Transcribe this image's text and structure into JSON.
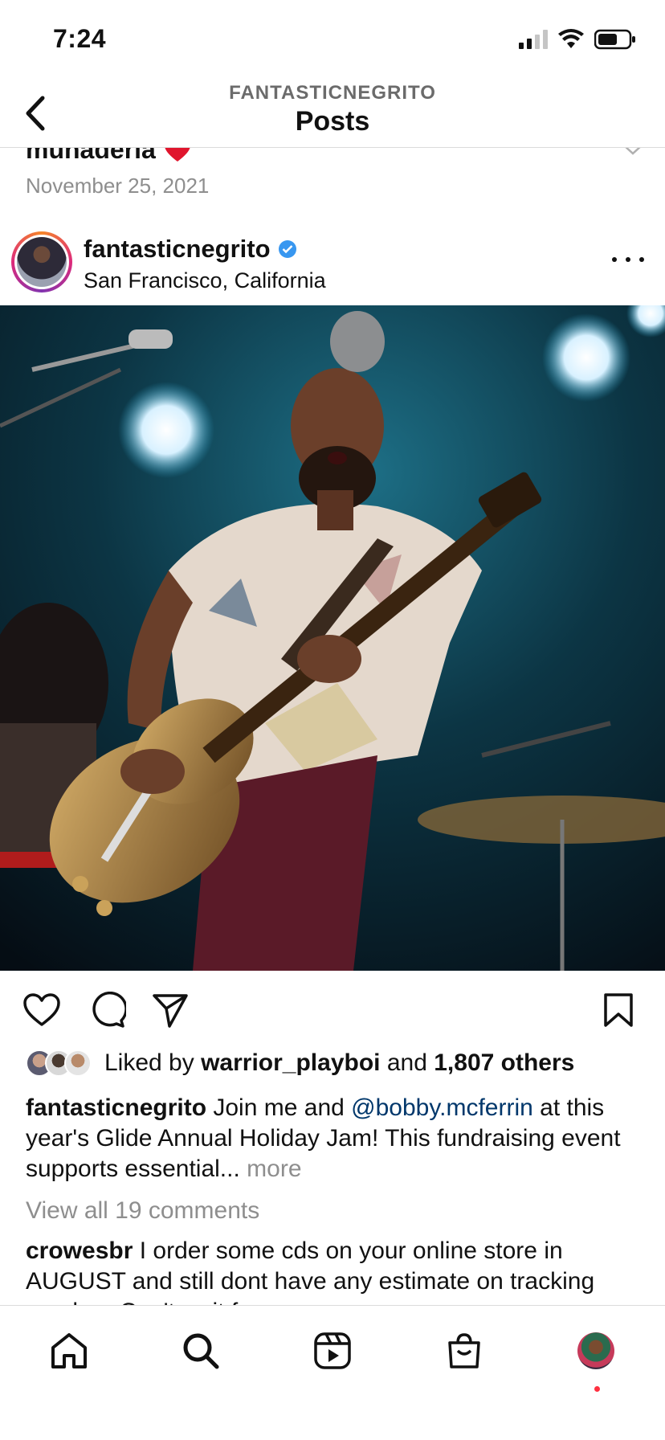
{
  "status_bar": {
    "time": "7:24",
    "signal_bars": 2,
    "battery_level": 0.55
  },
  "header": {
    "username": "FANTASTICNEGRITO",
    "title": "Posts"
  },
  "previous_post": {
    "caption_fragment": "muñadería",
    "date": "November 25, 2021"
  },
  "post": {
    "username": "fantasticnegrito",
    "location": "San Francisco, California",
    "verified": true,
    "likes": {
      "prefix": "Liked by",
      "liker": "warrior_playboi",
      "joiner": "and",
      "others": "1,807 others"
    },
    "caption": {
      "username": "fantasticnegrito",
      "text_before": "Join me and",
      "mention": "@bobby.mcferrin",
      "text_after": "at this year's Glide Annual Holiday Jam! This fundraising event supports essential...",
      "more_label": "more"
    },
    "view_comments": "View all 19 comments",
    "top_comment": {
      "username": "crowesbr",
      "text": "I order some cds on your online store in AUGUST and still dont have any estimate on tracking number. Can't wait for..."
    }
  },
  "icons": {
    "back": "chevron-left-icon",
    "like": "heart-icon",
    "comment": "comment-icon",
    "share": "send-icon",
    "save": "bookmark-icon"
  },
  "tab_bar": [
    "home",
    "search",
    "reels",
    "shop",
    "profile"
  ],
  "colors": {
    "accent_link": "#00376b",
    "verified": "#3897f0",
    "notification": "#ff3040",
    "muted": "#8e8e8e"
  }
}
